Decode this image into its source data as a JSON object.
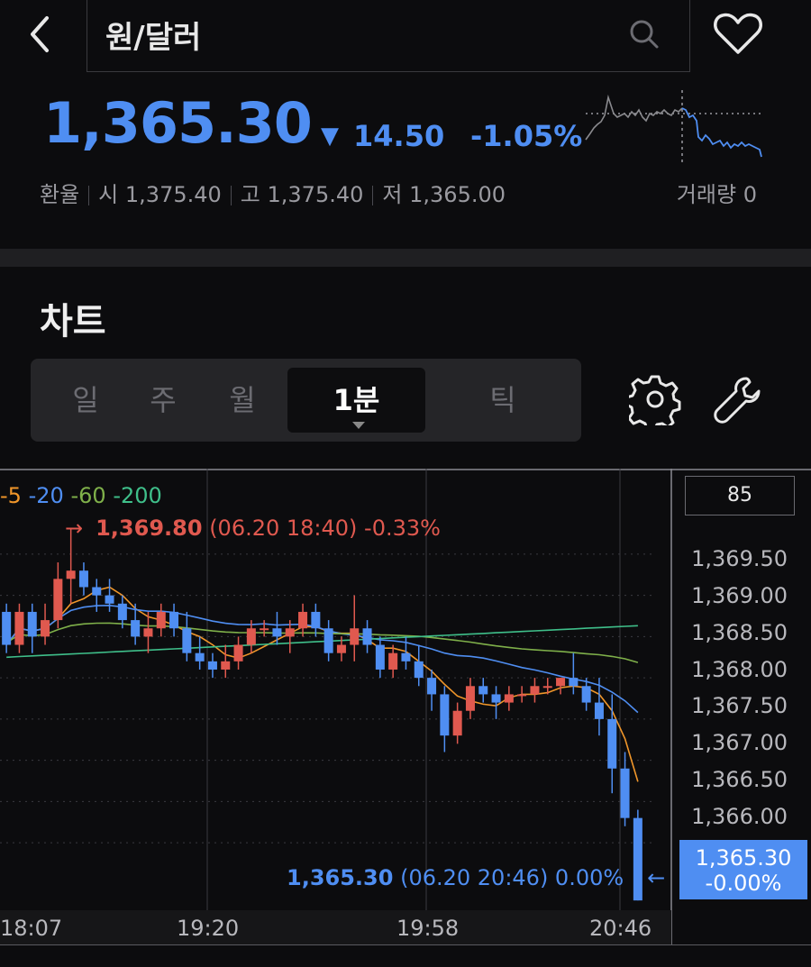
{
  "header": {
    "search_text": "원/달러",
    "price": "1,365.30",
    "change_arrow": "▼",
    "change_amount": "14.50",
    "change_percent": "-1.05%",
    "info": {
      "label": "환율",
      "open_label": "시",
      "open": "1,375.40",
      "high_label": "고",
      "high": "1,375.40",
      "low_label": "저",
      "low": "1,365.00"
    },
    "volume_label": "거래량",
    "volume": "0"
  },
  "section": {
    "title": "차트"
  },
  "tabs": [
    {
      "label": "일"
    },
    {
      "label": "주"
    },
    {
      "label": "월"
    },
    {
      "label": "1분",
      "active": true
    },
    {
      "label": "틱"
    }
  ],
  "chart_data": {
    "type": "candlestick",
    "moving_averages": [
      {
        "name": "5",
        "color": "#f0962a"
      },
      {
        "name": "20",
        "color": "#4f8ef2"
      },
      {
        "name": "60",
        "color": "#7fb04a"
      },
      {
        "name": "200",
        "color": "#3fbf8a"
      }
    ],
    "high_annotation": {
      "price": "1,369.80",
      "detail": "(06.20 18:40) -0.33%",
      "arrow": "→"
    },
    "low_annotation": {
      "price": "1,365.30",
      "detail": "(06.20 20:46) 0.00%",
      "arrow": "←"
    },
    "y_box": "85",
    "y_ticks": [
      "1,369.50",
      "1,369.00",
      "1,368.50",
      "1,368.00",
      "1,367.50",
      "1,367.00",
      "1,366.50",
      "1,366.00"
    ],
    "ylim": [
      1365.4,
      1370.1
    ],
    "x_ticks": [
      "18:07",
      "19:20",
      "19:58",
      "20:46"
    ],
    "current_price_tag": {
      "price": "1,365.30",
      "change": "-0.00%"
    },
    "colors": {
      "up": "#e0594f",
      "down": "#4f8ef2"
    },
    "candles": [
      [
        1368.8,
        1368.9,
        1368.3,
        1368.4
      ],
      [
        1368.4,
        1368.9,
        1368.3,
        1368.8
      ],
      [
        1368.8,
        1368.9,
        1368.3,
        1368.5
      ],
      [
        1368.5,
        1368.9,
        1368.4,
        1368.7
      ],
      [
        1368.7,
        1369.4,
        1368.6,
        1369.2
      ],
      [
        1369.2,
        1369.8,
        1368.9,
        1369.3
      ],
      [
        1369.3,
        1369.4,
        1369.0,
        1369.1
      ],
      [
        1369.1,
        1369.2,
        1368.8,
        1369.0
      ],
      [
        1369.0,
        1369.2,
        1368.8,
        1368.9
      ],
      [
        1368.9,
        1369.0,
        1368.6,
        1368.7
      ],
      [
        1368.7,
        1368.9,
        1368.4,
        1368.5
      ],
      [
        1368.5,
        1368.8,
        1368.3,
        1368.6
      ],
      [
        1368.6,
        1368.9,
        1368.5,
        1368.8
      ],
      [
        1368.8,
        1368.9,
        1368.5,
        1368.6
      ],
      [
        1368.6,
        1368.8,
        1368.2,
        1368.3
      ],
      [
        1368.3,
        1368.5,
        1368.1,
        1368.2
      ],
      [
        1368.2,
        1368.3,
        1368.0,
        1368.1
      ],
      [
        1368.1,
        1368.4,
        1368.0,
        1368.2
      ],
      [
        1368.2,
        1368.5,
        1368.1,
        1368.4
      ],
      [
        1368.4,
        1368.7,
        1368.3,
        1368.6
      ],
      [
        1368.6,
        1368.7,
        1368.5,
        1368.6
      ],
      [
        1368.6,
        1368.8,
        1368.4,
        1368.5
      ],
      [
        1368.5,
        1368.7,
        1368.3,
        1368.6
      ],
      [
        1368.6,
        1368.9,
        1368.5,
        1368.8
      ],
      [
        1368.8,
        1368.9,
        1368.5,
        1368.6
      ],
      [
        1368.6,
        1368.7,
        1368.2,
        1368.3
      ],
      [
        1368.3,
        1368.5,
        1368.2,
        1368.4
      ],
      [
        1368.4,
        1369.0,
        1368.2,
        1368.6
      ],
      [
        1368.6,
        1368.7,
        1368.3,
        1368.4
      ],
      [
        1368.4,
        1368.5,
        1368.0,
        1368.1
      ],
      [
        1368.1,
        1368.4,
        1368.0,
        1368.3
      ],
      [
        1368.3,
        1368.5,
        1368.1,
        1368.2
      ],
      [
        1368.2,
        1368.4,
        1367.9,
        1368.0
      ],
      [
        1368.0,
        1368.1,
        1367.6,
        1367.8
      ],
      [
        1367.8,
        1367.9,
        1367.1,
        1367.3
      ],
      [
        1367.3,
        1367.7,
        1367.2,
        1367.6
      ],
      [
        1367.6,
        1368.0,
        1367.5,
        1367.9
      ],
      [
        1367.9,
        1368.0,
        1367.7,
        1367.8
      ],
      [
        1367.8,
        1367.9,
        1367.5,
        1367.7
      ],
      [
        1367.7,
        1367.9,
        1367.6,
        1367.8
      ],
      [
        1367.8,
        1367.9,
        1367.7,
        1367.8
      ],
      [
        1367.8,
        1368.0,
        1367.7,
        1367.9
      ],
      [
        1367.9,
        1368.0,
        1367.8,
        1367.9
      ],
      [
        1367.9,
        1368.0,
        1367.8,
        1368.0
      ],
      [
        1368.0,
        1368.3,
        1367.8,
        1367.9
      ],
      [
        1367.9,
        1368.0,
        1367.6,
        1367.7
      ],
      [
        1367.7,
        1368.0,
        1367.3,
        1367.5
      ],
      [
        1367.5,
        1367.8,
        1366.6,
        1366.9
      ],
      [
        1366.9,
        1367.1,
        1366.2,
        1366.3
      ],
      [
        1366.3,
        1366.4,
        1365.3,
        1365.3
      ]
    ]
  }
}
